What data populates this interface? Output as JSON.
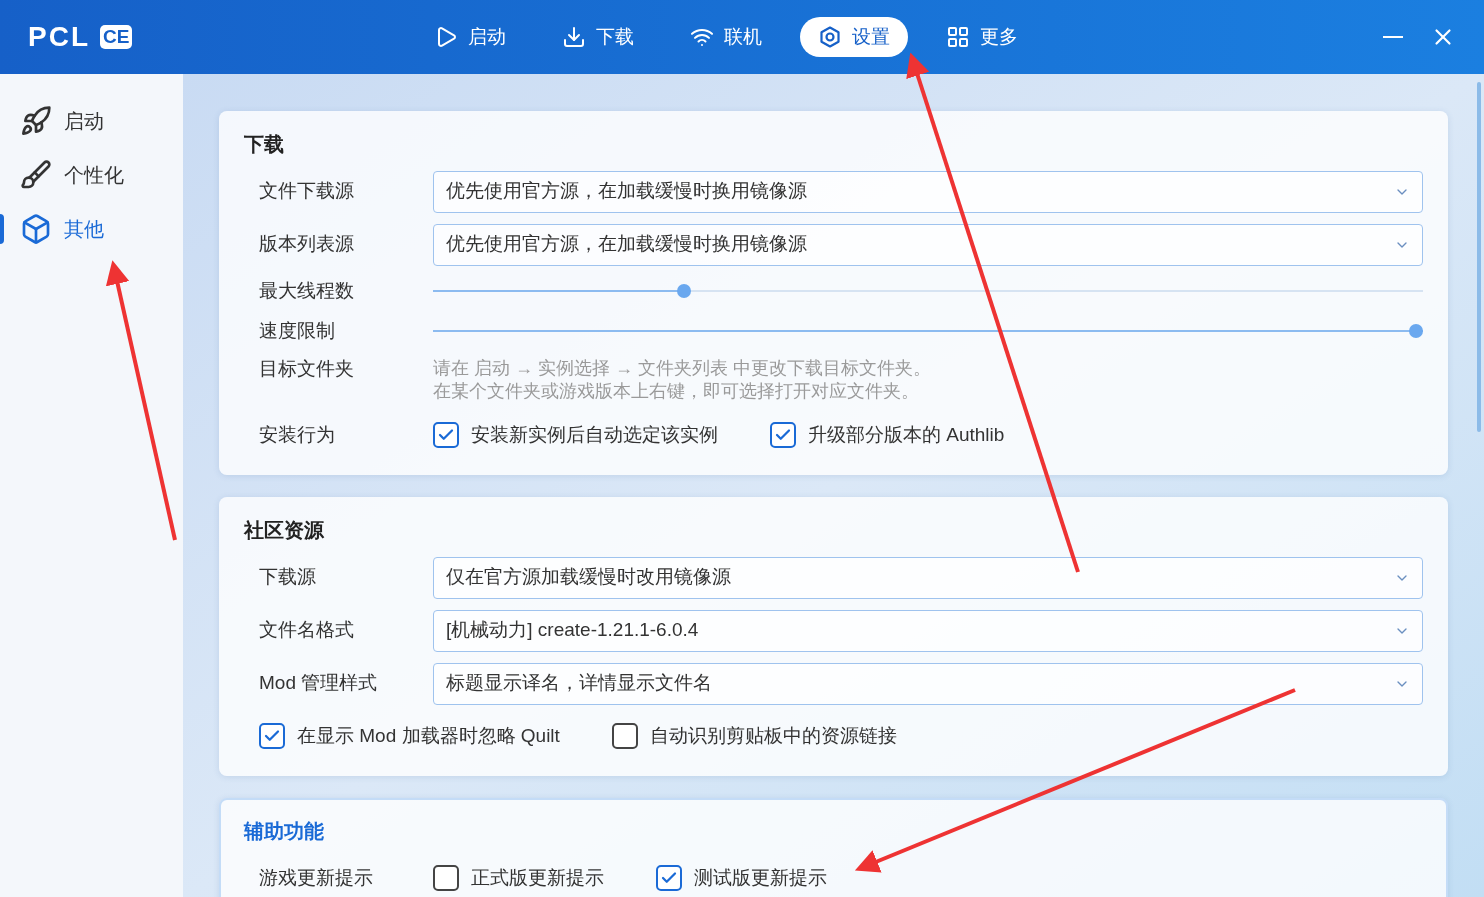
{
  "app": {
    "name": "PCL",
    "badge": "CE"
  },
  "nav": [
    {
      "label": "启动",
      "selected": false
    },
    {
      "label": "下载",
      "selected": false
    },
    {
      "label": "联机",
      "selected": false
    },
    {
      "label": "设置",
      "selected": true
    },
    {
      "label": "更多",
      "selected": false
    }
  ],
  "sidebar": [
    {
      "label": "启动",
      "selected": false
    },
    {
      "label": "个性化",
      "selected": false
    },
    {
      "label": "其他",
      "selected": true
    }
  ],
  "sections": [
    {
      "title": "下载",
      "highlighted": false,
      "rows": [
        {
          "kind": "dropdown",
          "label": "文件下载源",
          "value": "优先使用官方源，在加载缓慢时换用镜像源"
        },
        {
          "kind": "dropdown",
          "label": "版本列表源",
          "value": "优先使用官方源，在加载缓慢时换用镜像源"
        },
        {
          "kind": "slider",
          "label": "最大线程数",
          "level": 0.25
        },
        {
          "kind": "slider",
          "label": "速度限制",
          "level": 1
        },
        {
          "kind": "text",
          "label": "目标文件夹",
          "lines": [
            "请在 启动 → 实例选择 → 文件夹列表 中更改下载目标文件夹。",
            "在某个文件夹或游戏版本上右键，即可选择打开对应文件夹。"
          ]
        },
        {
          "kind": "checks",
          "label": "安装行为",
          "options": [
            {
              "label": "安装新实例后自动选定该实例",
              "checked": true
            },
            {
              "label": "升级部分版本的 Authlib",
              "checked": true
            }
          ]
        }
      ]
    },
    {
      "title": "社区资源",
      "highlighted": false,
      "rows": [
        {
          "kind": "dropdown",
          "label": "下载源",
          "value": "仅在官方源加载缓慢时改用镜像源"
        },
        {
          "kind": "dropdown",
          "label": "文件名格式",
          "value": "[机械动力] create-1.21.1-6.0.4"
        },
        {
          "kind": "dropdown",
          "label": "Mod 管理样式",
          "value": "标题显示译名，详情显示文件名"
        },
        {
          "kind": "checks",
          "options": [
            {
              "label": "在显示 Mod 加载器时忽略 Quilt",
              "checked": true
            },
            {
              "label": "自动识别剪贴板中的资源链接",
              "checked": false
            }
          ]
        }
      ]
    },
    {
      "title": "辅助功能",
      "highlighted": true,
      "rows": [
        {
          "kind": "checks",
          "label": "游戏更新提示",
          "options": [
            {
              "label": "正式版更新提示",
              "checked": false
            },
            {
              "label": "测试版更新提示",
              "checked": true
            }
          ]
        }
      ]
    }
  ]
}
